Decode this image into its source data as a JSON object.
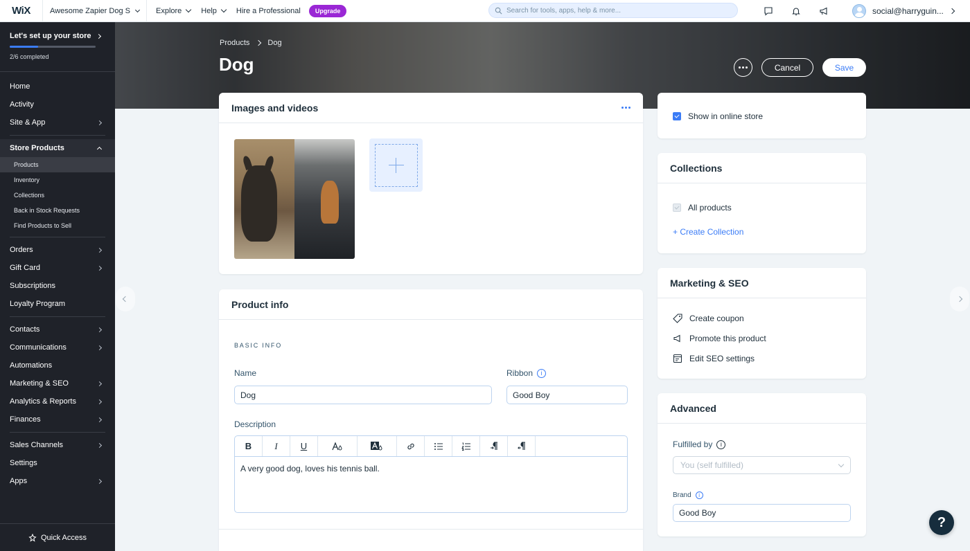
{
  "topbar": {
    "logo": "WiX",
    "site_name": "Awesome Zapier Dog S",
    "nav": [
      "Explore",
      "Help",
      "Hire a Professional"
    ],
    "upgrade": "Upgrade",
    "search_placeholder": "Search for tools, apps, help & more...",
    "user_email": "social@harryguin..."
  },
  "sidebar": {
    "setup_title": "Let's set up your store",
    "setup_progress_fraction": 0.333,
    "setup_count": "2/6 completed",
    "items_top": [
      "Home",
      "Activity",
      "Site & App"
    ],
    "store_products": "Store Products",
    "store_sub": [
      "Products",
      "Inventory",
      "Collections",
      "Back in Stock Requests",
      "Find Products to Sell"
    ],
    "items_mid": [
      "Orders",
      "Gift Card",
      "Subscriptions",
      "Loyalty Program"
    ],
    "items_bottom": [
      "Contacts",
      "Communications",
      "Automations",
      "Marketing & SEO",
      "Analytics & Reports",
      "Finances"
    ],
    "items_last": [
      "Sales Channels",
      "Settings",
      "Apps"
    ],
    "quick_access": "Quick Access"
  },
  "page": {
    "breadcrumb": [
      "Products",
      "Dog"
    ],
    "title": "Dog",
    "cancel": "Cancel",
    "save": "Save"
  },
  "media": {
    "title": "Images and videos"
  },
  "product_info": {
    "title": "Product info",
    "section": "BASIC INFO",
    "name_label": "Name",
    "name_value": "Dog",
    "ribbon_label": "Ribbon",
    "ribbon_value": "Good Boy",
    "description_label": "Description",
    "description_value": "A very good dog, loves his tennis ball."
  },
  "visibility": {
    "show_online": "Show in online store"
  },
  "collections": {
    "title": "Collections",
    "all_products": "All products",
    "create": "+ Create Collection"
  },
  "marketing": {
    "title": "Marketing & SEO",
    "items": [
      "Create coupon",
      "Promote this product",
      "Edit SEO settings"
    ]
  },
  "advanced": {
    "title": "Advanced",
    "fulfilled_label": "Fulfilled by",
    "fulfilled_value": "You (self fulfilled)",
    "brand_label": "Brand",
    "brand_value": "Good Boy"
  },
  "help": "?"
}
